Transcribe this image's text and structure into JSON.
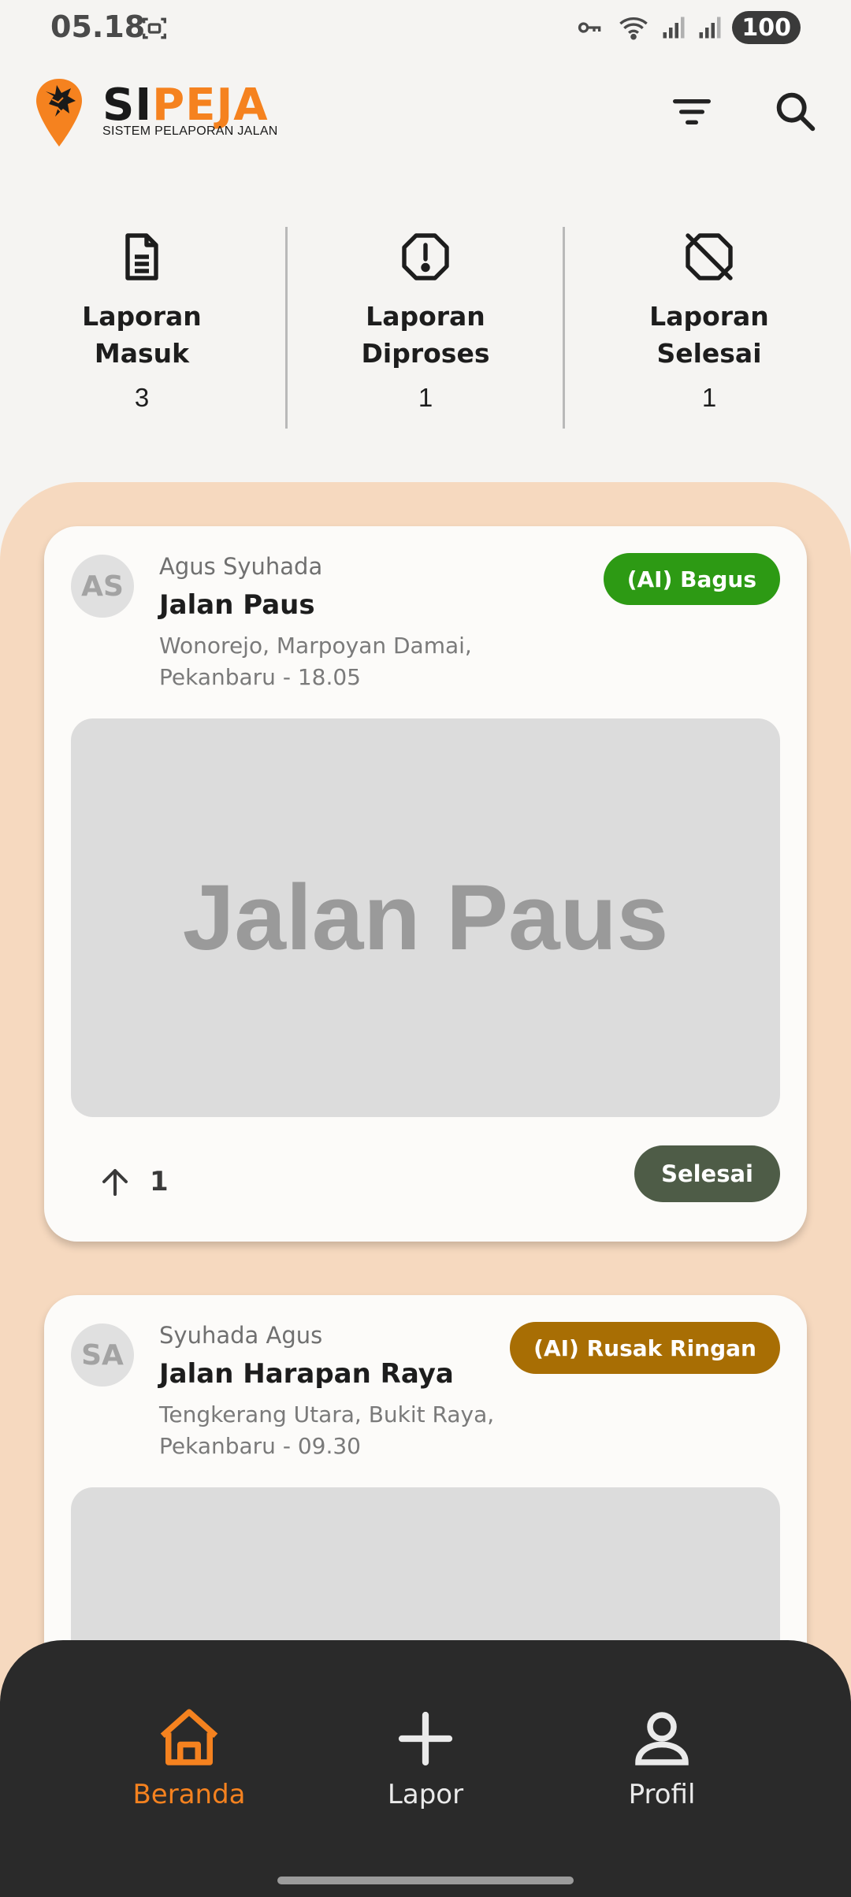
{
  "status_bar": {
    "time": "05.18",
    "battery": "100",
    "icons": [
      "screenshot-icon",
      "vpn-key-icon",
      "wifi-icon",
      "signal-icon",
      "signal-icon-2"
    ]
  },
  "header": {
    "logo_si": "SI",
    "logo_peja": "PEJA",
    "logo_subtitle": "SISTEM PELAPORAN JALAN",
    "icons": [
      "filter-icon",
      "search-icon"
    ]
  },
  "stats": [
    {
      "label": "Laporan Masuk",
      "count": "3",
      "icon": "document-icon"
    },
    {
      "label": "Laporan Diproses",
      "count": "1",
      "icon": "alert-octagon-icon"
    },
    {
      "label": "Laporan Selesai",
      "count": "1",
      "icon": "octagon-off-icon"
    }
  ],
  "reports": [
    {
      "initials": "AS",
      "author": "Agus Syuhada",
      "road": "Jalan Paus",
      "location": "Wonorejo, Marpoyan Damai, Pekanbaru - 18.05",
      "badge": "(AI) Bagus",
      "photo_text": "Jalan Paus",
      "upvotes": "1",
      "status": "Selesai"
    },
    {
      "initials": "SA",
      "author": "Syuhada Agus",
      "road": "Jalan Harapan Raya",
      "location": "Tengkerang Utara, Bukit Raya, Pekanbaru - 09.30",
      "badge": "(AI) Rusak Ringan"
    }
  ],
  "colors": {
    "accent": "#f5821f",
    "badge_good": "#2d9a14",
    "badge_light_damage": "#a86e04",
    "status_done": "#4e5c47",
    "feed_bg": "#f6d9bf",
    "nav_bg": "#2a2a2a"
  },
  "bottom_nav": [
    {
      "label": "Beranda",
      "icon": "home-icon",
      "active": true
    },
    {
      "label": "Lapor",
      "icon": "plus-icon",
      "active": false
    },
    {
      "label": "Profil",
      "icon": "person-icon",
      "active": false
    }
  ]
}
